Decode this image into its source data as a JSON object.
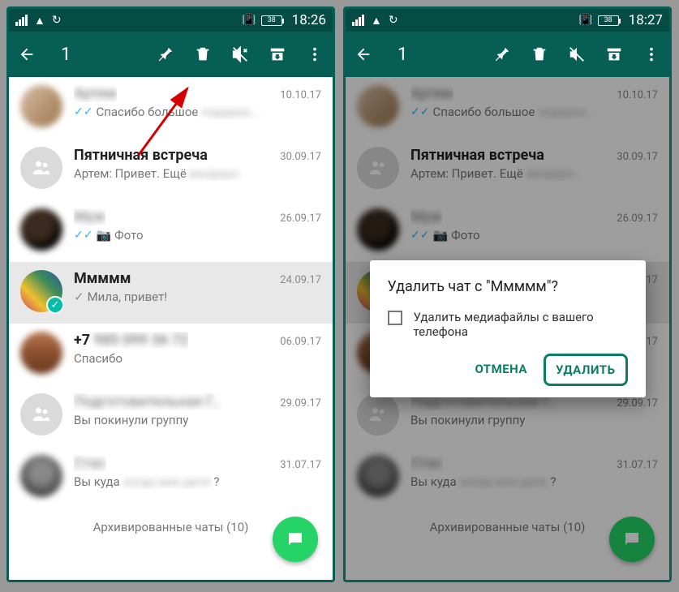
{
  "left": {
    "status_time": "18:26",
    "battery": "38",
    "selection_count": "1",
    "chats": [
      {
        "name": "Артем",
        "msg_prefix": "Спасибо большое",
        "date": "10.10.17",
        "ticks": true,
        "avatar": "a1",
        "blurname": true
      },
      {
        "name": "Пятничная встреча",
        "msg_prefix": "Артем: Привет. Ещё",
        "date": "30.09.17",
        "bold": true,
        "avatar": "group"
      },
      {
        "name": "Муж",
        "msg_prefix": "Фото",
        "date": "26.09.17",
        "ticks": true,
        "camera": true,
        "avatar": "a3",
        "blurname": true
      },
      {
        "name": "Ммммм",
        "msg_prefix": "Мила, привет!",
        "date": "24.09.17",
        "bold": true,
        "selected": true,
        "singletick": true,
        "avatar": "a4",
        "checked": true
      },
      {
        "name": "+7",
        "msg_prefix": "Спасибо",
        "date": "06.09.17",
        "avatar": "a5",
        "blurtail": true
      },
      {
        "name": "Подготовительная Г…",
        "msg_prefix": "Вы покинули группу",
        "date": "29.09.17",
        "avatar": "group",
        "blurname": true
      },
      {
        "name": "Стас",
        "msg_prefix": "Вы куда",
        "msg_suffix": "?",
        "date": "31.07.17",
        "avatar": "a7",
        "blurname": true
      }
    ],
    "archived_label": "Архивированные чаты (10)"
  },
  "right": {
    "status_time": "18:27",
    "battery": "38",
    "selection_count": "1",
    "dialog": {
      "title": "Удалить чат с \"Ммммм\"?",
      "checkbox_label": "Удалить медиафайлы с вашего телефона",
      "cancel": "ОТМЕНА",
      "confirm": "УДАЛИТЬ"
    }
  }
}
